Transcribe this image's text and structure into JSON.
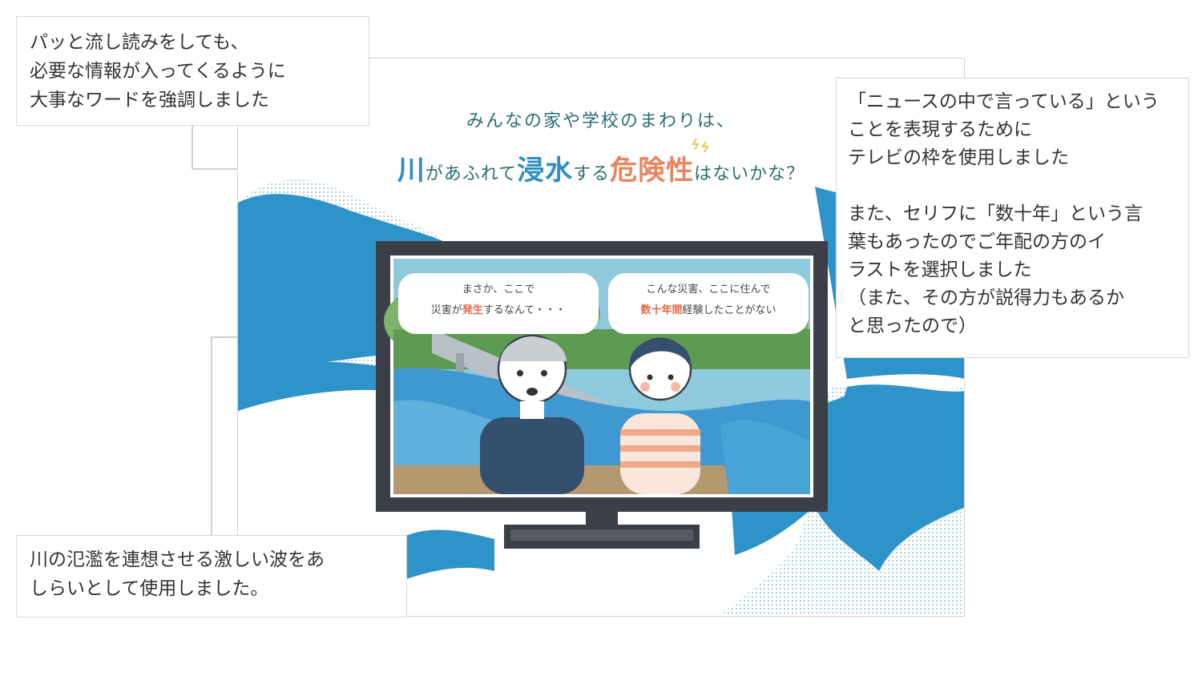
{
  "notes": {
    "top_left": "パッと流し読みをしても、\n必要な情報が入ってくるように\n大事なワードを強調しました",
    "right_1": "「ニュースの中で言っている」という\nことを表現するために\nテレビの枠を使用しました",
    "right_2": "また、セリフに「数十年」という言\n葉もあったのでご年配の方のイ\nラストを選択しました\n（また、その方が説得力もあるか\nと思ったので）",
    "bottom_left": "川の氾濫を連想させる激しい波をあ\nしらいとして使用しました。"
  },
  "slide": {
    "subtitle": "みんなの家や学校のまわりは、",
    "headline": {
      "w1": "川",
      "w2": "があふれて",
      "w3": "浸水",
      "w4": "する",
      "w5": "危険性",
      "w6": "はないかな？"
    },
    "bubble_left": {
      "line1": "まさか、ここで",
      "line2a": "災害が",
      "line2b": "発生",
      "line2c": "するなんて・・・"
    },
    "bubble_right": {
      "line1": "こんな災害、ここに住んで",
      "line2a": "数十年間",
      "line2b": "経験したことがない"
    }
  },
  "colors": {
    "wave_blue": "#2e93c9",
    "wave_light": "#bfe0ef",
    "tv_frame": "#3b3f47",
    "accent_orange": "#e8664a",
    "title_teal": "#2a6e72"
  }
}
